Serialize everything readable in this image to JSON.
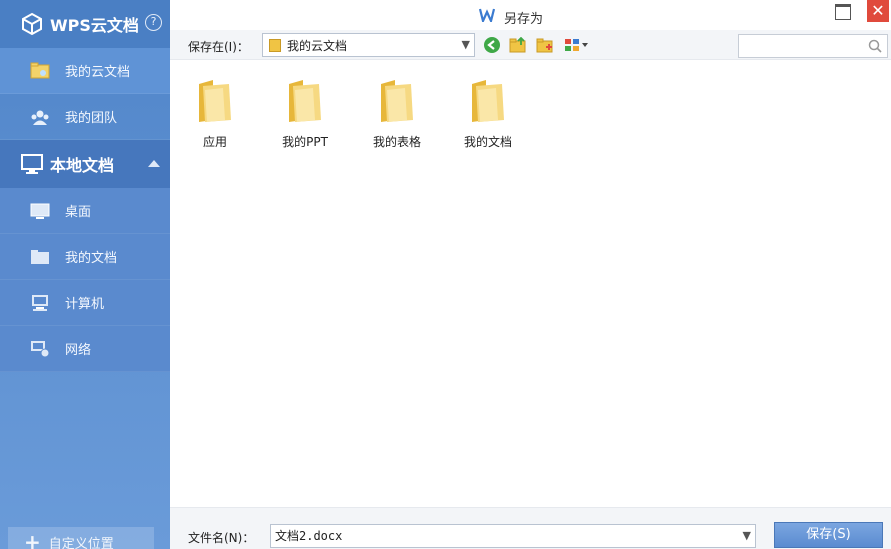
{
  "sidebar": {
    "brand": "WPS云文档",
    "help_icon": "?",
    "cloud_items": [
      {
        "label": "我的云文档",
        "icon": "cloud-folder-icon"
      },
      {
        "label": "我的团队",
        "icon": "team-icon"
      }
    ],
    "local_section": {
      "label": "本地文档",
      "icon": "monitor-icon"
    },
    "local_items": [
      {
        "label": "桌面",
        "icon": "desktop-icon"
      },
      {
        "label": "我的文档",
        "icon": "documents-folder-icon"
      },
      {
        "label": "计算机",
        "icon": "computer-icon"
      },
      {
        "label": "网络",
        "icon": "network-icon"
      }
    ],
    "custom_location": "自定义位置"
  },
  "dialog": {
    "title": "另存为",
    "close": "✕"
  },
  "toolbar": {
    "save_in_label": "保存在(I)：",
    "location": "我的云文档",
    "search_placeholder": ""
  },
  "files": [
    {
      "name": "应用"
    },
    {
      "name": "我的PPT"
    },
    {
      "name": "我的表格"
    },
    {
      "name": "我的文档"
    }
  ],
  "footer": {
    "filename_label": "文件名(N)：",
    "filename_value": "文档2.docx",
    "save_button": "保存(S)"
  },
  "colors": {
    "sidebar": "#5a8ace",
    "accent": "#5a8bd0",
    "close": "#e04a3c",
    "folder": "#f0c444"
  }
}
